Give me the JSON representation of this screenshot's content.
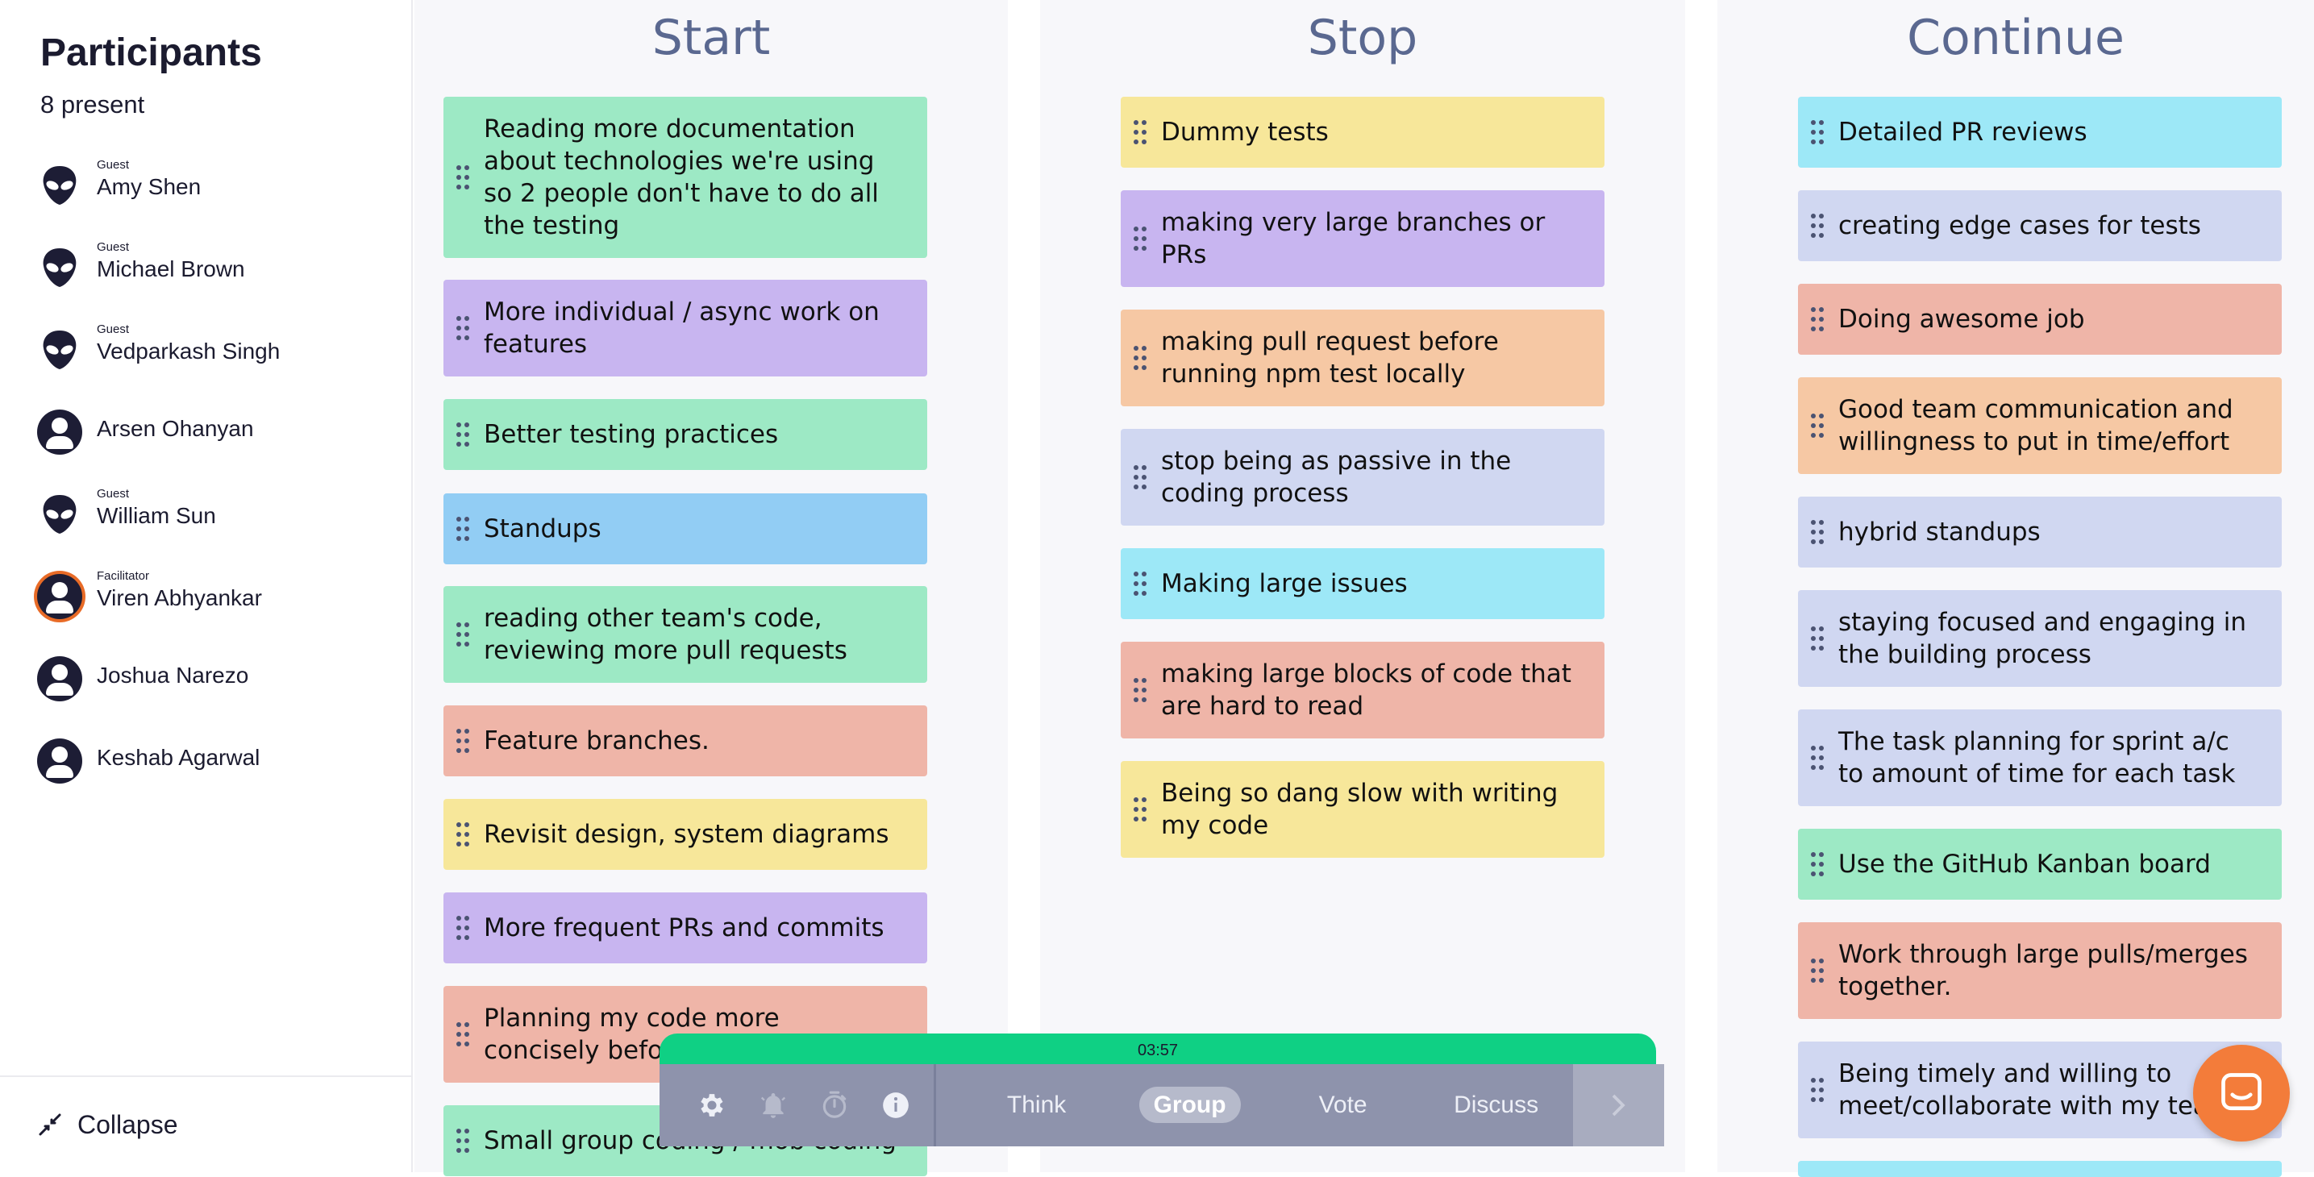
{
  "sidebar": {
    "title": "Participants",
    "count": "8 present",
    "participants": [
      {
        "role": "Guest",
        "name": "Amy Shen",
        "avatar": "alien-icon"
      },
      {
        "role": "Guest",
        "name": "Michael Brown",
        "avatar": "alien-icon"
      },
      {
        "role": "Guest",
        "name": "Vedparkash Singh",
        "avatar": "alien-icon"
      },
      {
        "role": "",
        "name": "Arsen Ohanyan",
        "avatar": "user-icon"
      },
      {
        "role": "Guest",
        "name": "William Sun",
        "avatar": "alien-icon"
      },
      {
        "role": "Facilitator",
        "name": "Viren Abhyankar",
        "avatar": "user-icon"
      },
      {
        "role": "",
        "name": "Joshua Narezo",
        "avatar": "user-icon"
      },
      {
        "role": "",
        "name": "Keshab Agarwal",
        "avatar": "user-icon"
      }
    ],
    "collapse_label": "Collapse"
  },
  "columns": [
    {
      "title": "Start",
      "cards": [
        {
          "text": "Reading more documentation about technologies we're using so 2 people don't have to do all the testing",
          "color": "#9de9c5"
        },
        {
          "text": "More individual / async work on features",
          "color": "#c8b5f0"
        },
        {
          "text": "Better testing practices",
          "color": "#9de9c5"
        },
        {
          "text": "Standups",
          "color": "#92cdf4"
        },
        {
          "text": "reading other team's code, reviewing more pull requests",
          "color": "#9de9c5"
        },
        {
          "text": "Feature branches.",
          "color": "#efb5a8"
        },
        {
          "text": "Revisit design, system diagrams",
          "color": "#f7e79a"
        },
        {
          "text": "More frequent PRs and commits",
          "color": "#c8b5f0"
        },
        {
          "text": "Planning my code more concisely before starting",
          "color": "#efb5a8"
        },
        {
          "text": "Small group coding / mob coding",
          "color": "#9de9c5"
        }
      ]
    },
    {
      "title": "Stop",
      "cards": [
        {
          "text": "Dummy tests",
          "color": "#f7e79a"
        },
        {
          "text": "making very large branches or PRs",
          "color": "#c8b5f0"
        },
        {
          "text": "making pull request before running npm test locally",
          "color": "#f6c8a4"
        },
        {
          "text": "stop being as passive in the coding process",
          "color": "#d0d7f1"
        },
        {
          "text": "Making large issues",
          "color": "#9de8f7"
        },
        {
          "text": "making large blocks of code that are hard to read",
          "color": "#efb5a8"
        },
        {
          "text": "Being so dang slow with writing my code",
          "color": "#f7e79a"
        }
      ]
    },
    {
      "title": "Continue",
      "cards": [
        {
          "text": "Detailed PR reviews",
          "color": "#9de8f7"
        },
        {
          "text": "creating edge cases for tests",
          "color": "#d0d7f1"
        },
        {
          "text": "Doing awesome job",
          "color": "#efb5a8"
        },
        {
          "text": "Good team communication and willingness to put in time/effort",
          "color": "#f6c8a4"
        },
        {
          "text": "hybrid standups",
          "color": "#d0d7f1"
        },
        {
          "text": "staying focused and engaging in the building process",
          "color": "#d0d7f1"
        },
        {
          "text": "The task planning for sprint a/c to amount of time for each task",
          "color": "#d0d7f1"
        },
        {
          "text": "Use the GitHub Kanban board",
          "color": "#9de9c5"
        },
        {
          "text": "Work through large pulls/merges together.",
          "color": "#efb5a8"
        },
        {
          "text": "Being timely and willing to meet/collaborate with my team",
          "color": "#d0d7f1"
        }
      ]
    }
  ],
  "toolbar": {
    "timer": "03:57",
    "icons": [
      "gear-icon",
      "bell-icon",
      "stopwatch-icon",
      "info-icon"
    ],
    "phases": [
      "Think",
      "Group",
      "Vote",
      "Discuss"
    ],
    "active_phase": "Group",
    "next_icon": "chevron-right-icon"
  },
  "help": {
    "icon": "chat-icon",
    "color": "#f37c3a"
  }
}
